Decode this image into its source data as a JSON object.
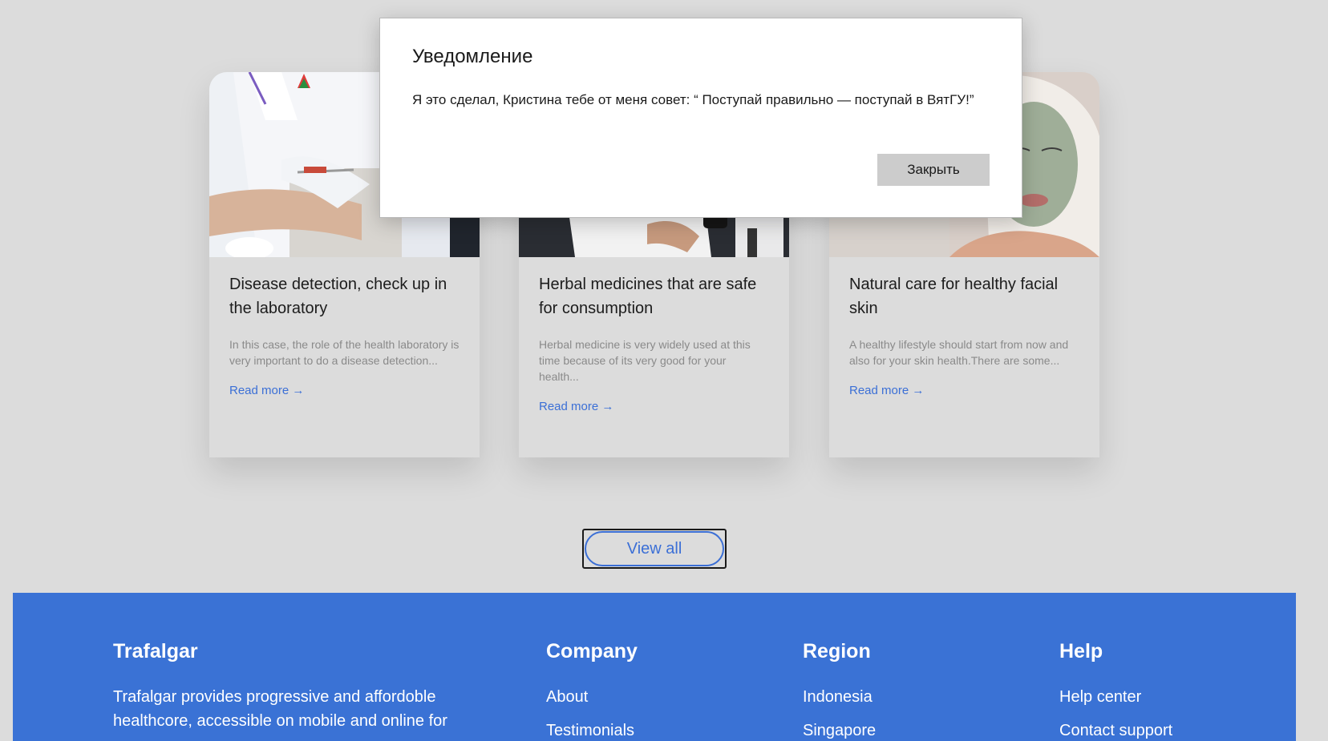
{
  "cards": [
    {
      "title": "Disease detection, check up in the laboratory",
      "excerpt": "In this case, the role of the health laboratory is very important to do a disease detection...",
      "link": "Read more →"
    },
    {
      "title": "Herbal medicines that are safe for consumption",
      "excerpt": "Herbal medicine is very widely used at this time because of its very good for your health...",
      "link": "Read more →"
    },
    {
      "title": "Natural care for healthy facial skin",
      "excerpt": "A healthy lifestyle should start from now and also for your skin health.There are some...",
      "link": "Read more →"
    }
  ],
  "view_all_label": "View all",
  "footer": {
    "brand": "Trafalgar",
    "description": "Trafalgar provides progressive and affordoble healthcore, accessible on mobile and online for",
    "columns": [
      {
        "heading": "Company",
        "links": [
          "About",
          "Testimonials"
        ]
      },
      {
        "heading": "Region",
        "links": [
          "Indonesia",
          "Singapore"
        ]
      },
      {
        "heading": "Help",
        "links": [
          "Help center",
          "Contact support"
        ]
      }
    ]
  },
  "modal": {
    "title": "Уведомление",
    "message": "Я это сделал, Кристина тебе от меня совет: “ Поступай правильно — поступай в ВятГУ!”",
    "close_label": "Закрыть"
  },
  "colors": {
    "accent": "#3b6fd6",
    "footer_bg": "#3a72d5",
    "page_bg": "#dcdcdc"
  }
}
